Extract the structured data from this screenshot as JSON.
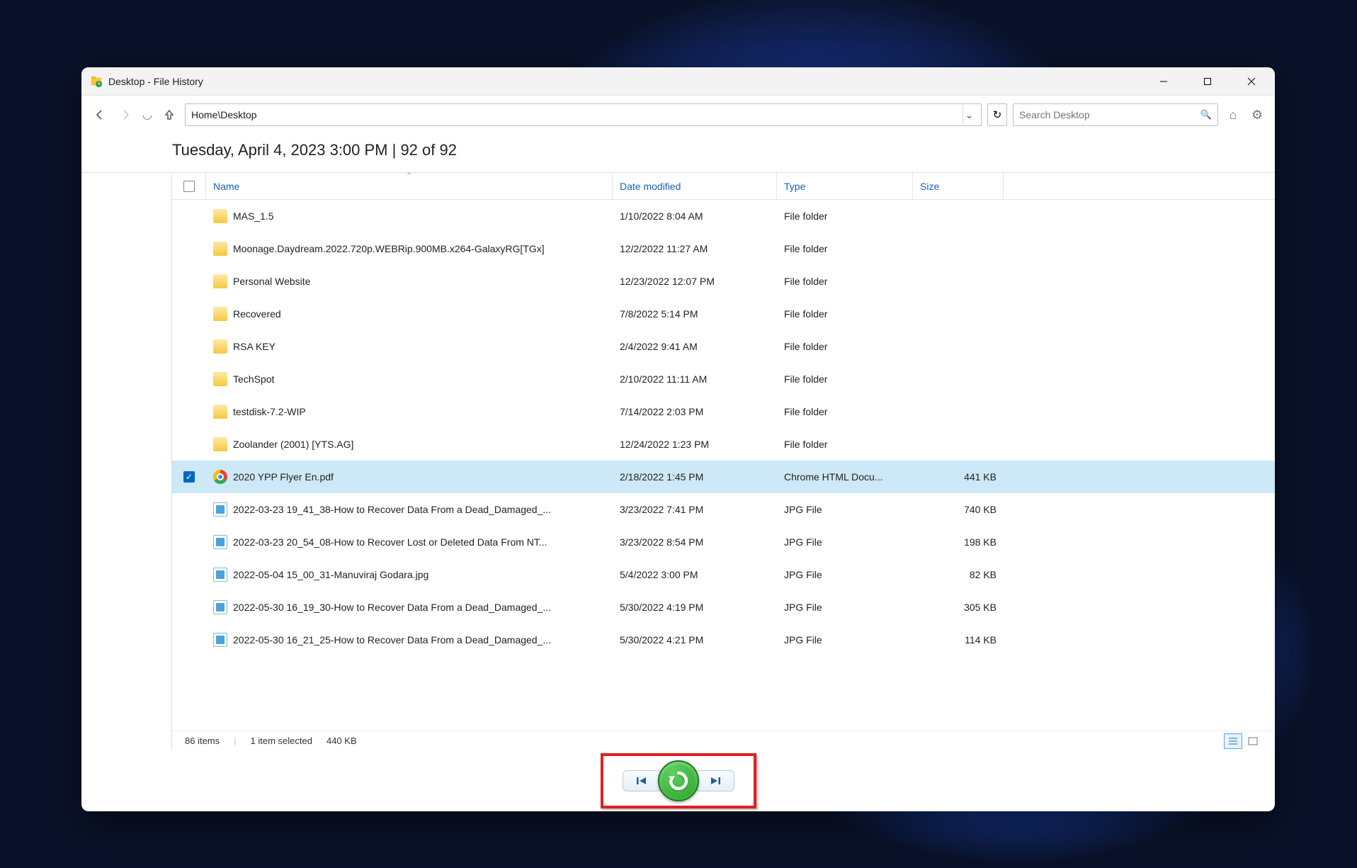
{
  "window": {
    "title": "Desktop - File History"
  },
  "toolbar": {
    "path": "Home\\Desktop",
    "search_placeholder": "Search Desktop"
  },
  "snapshot": {
    "label": "Tuesday, April 4, 2023 3:00 PM   |   92 of 92"
  },
  "columns": {
    "name": "Name",
    "date": "Date modified",
    "type": "Type",
    "size": "Size"
  },
  "files": [
    {
      "icon": "folder",
      "name": "MAS_1.5",
      "date": "1/10/2022 8:04 AM",
      "type": "File folder",
      "size": "",
      "selected": false
    },
    {
      "icon": "folder",
      "name": "Moonage.Daydream.2022.720p.WEBRip.900MB.x264-GalaxyRG[TGx]",
      "date": "12/2/2022 11:27 AM",
      "type": "File folder",
      "size": "",
      "selected": false
    },
    {
      "icon": "folder",
      "name": "Personal Website",
      "date": "12/23/2022 12:07 PM",
      "type": "File folder",
      "size": "",
      "selected": false
    },
    {
      "icon": "folder",
      "name": "Recovered",
      "date": "7/8/2022 5:14 PM",
      "type": "File folder",
      "size": "",
      "selected": false
    },
    {
      "icon": "folder",
      "name": "RSA KEY",
      "date": "2/4/2022 9:41 AM",
      "type": "File folder",
      "size": "",
      "selected": false
    },
    {
      "icon": "folder",
      "name": "TechSpot",
      "date": "2/10/2022 11:11 AM",
      "type": "File folder",
      "size": "",
      "selected": false
    },
    {
      "icon": "folder",
      "name": "testdisk-7.2-WIP",
      "date": "7/14/2022 2:03 PM",
      "type": "File folder",
      "size": "",
      "selected": false
    },
    {
      "icon": "folder",
      "name": "Zoolander (2001) [YTS.AG]",
      "date": "12/24/2022 1:23 PM",
      "type": "File folder",
      "size": "",
      "selected": false
    },
    {
      "icon": "chrome",
      "name": "2020 YPP Flyer En.pdf",
      "date": "2/18/2022 1:45 PM",
      "type": "Chrome HTML Docu...",
      "size": "441 KB",
      "selected": true
    },
    {
      "icon": "jpg",
      "name": "2022-03-23 19_41_38-How to Recover Data From a Dead_Damaged_...",
      "date": "3/23/2022 7:41 PM",
      "type": "JPG File",
      "size": "740 KB",
      "selected": false
    },
    {
      "icon": "jpg",
      "name": "2022-03-23 20_54_08-How to Recover Lost or Deleted Data From NT...",
      "date": "3/23/2022 8:54 PM",
      "type": "JPG File",
      "size": "198 KB",
      "selected": false
    },
    {
      "icon": "jpg",
      "name": "2022-05-04 15_00_31-Manuviraj Godara.jpg",
      "date": "5/4/2022 3:00 PM",
      "type": "JPG File",
      "size": "82 KB",
      "selected": false
    },
    {
      "icon": "jpg",
      "name": "2022-05-30 16_19_30-How to Recover Data From a Dead_Damaged_...",
      "date": "5/30/2022 4:19 PM",
      "type": "JPG File",
      "size": "305 KB",
      "selected": false
    },
    {
      "icon": "jpg",
      "name": "2022-05-30 16_21_25-How to Recover Data From a Dead_Damaged_...",
      "date": "5/30/2022 4:21 PM",
      "type": "JPG File",
      "size": "114 KB",
      "selected": false
    }
  ],
  "status": {
    "count": "86 items",
    "selection": "1 item selected",
    "selsize": "440 KB"
  }
}
